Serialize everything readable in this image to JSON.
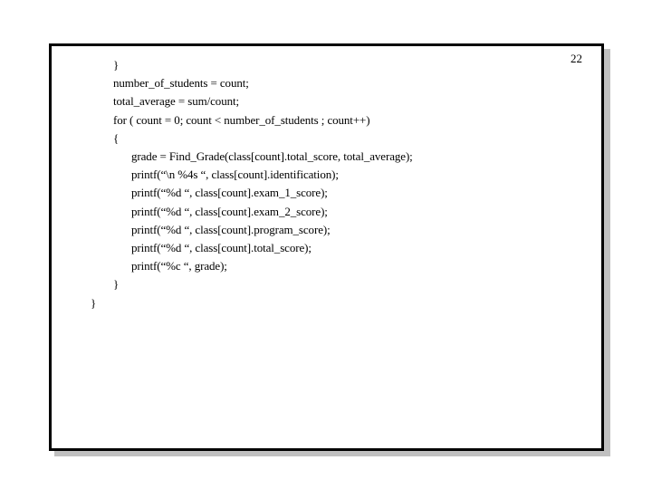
{
  "slide": {
    "page_number": "22",
    "code_lines": [
      {
        "indent": 1,
        "text": "}"
      },
      {
        "indent": 1,
        "text": "number_of_students = count;"
      },
      {
        "indent": 1,
        "text": "total_average = sum/count;"
      },
      {
        "indent": 1,
        "text": "for ( count = 0; count < number_of_students ; count++)"
      },
      {
        "indent": 1,
        "text": "{"
      },
      {
        "indent": 2,
        "text": "grade = Find_Grade(class[count].total_score, total_average);"
      },
      {
        "indent": 2,
        "text": "printf(“\\n %4s “, class[count].identification);"
      },
      {
        "indent": 2,
        "text": "printf(“%d “, class[count].exam_1_score);"
      },
      {
        "indent": 2,
        "text": "printf(“%d “, class[count].exam_2_score);"
      },
      {
        "indent": 2,
        "text": "printf(“%d “, class[count].program_score);"
      },
      {
        "indent": 2,
        "text": "printf(“%d “, class[count].total_score);"
      },
      {
        "indent": 2,
        "text": "printf(“%c “, grade);"
      },
      {
        "indent": 1,
        "text": "}"
      },
      {
        "indent": 0,
        "text": "}"
      }
    ]
  }
}
